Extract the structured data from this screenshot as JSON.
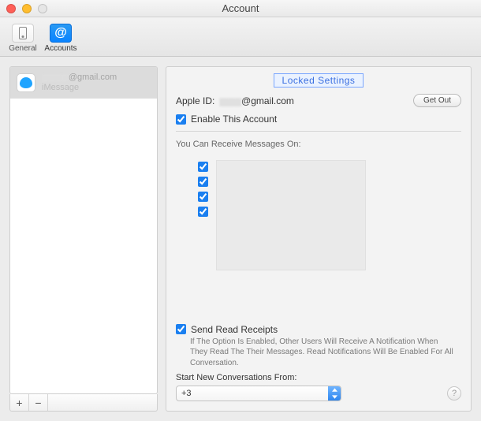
{
  "window": {
    "title": "Account"
  },
  "toolbar": {
    "general": "General",
    "accounts": "Accounts"
  },
  "sidebar": {
    "account": {
      "masked_email": "@gmail.com",
      "type": "iMessage"
    },
    "add": "+",
    "remove": "−"
  },
  "detail": {
    "locked_banner": "Locked Settings",
    "apple_id_label": "Apple ID:",
    "apple_id_value": "@gmail.com",
    "signout": "Get Out",
    "enable_label": "Enable This Account",
    "enable_checked": true,
    "receive_label": "You Can Receive Messages On:",
    "receive_items": [
      true,
      true,
      true,
      true
    ],
    "receipts_label": "Send Read Receipts",
    "receipts_checked": true,
    "receipts_desc": "If The Option Is Enabled, Other Users Will Receive A Notification When They Read The Their Messages. Read Notifications Will Be Enabled For All Conversation.",
    "start_label": "Start New Conversations From:",
    "start_value": "+3",
    "help": "?"
  }
}
